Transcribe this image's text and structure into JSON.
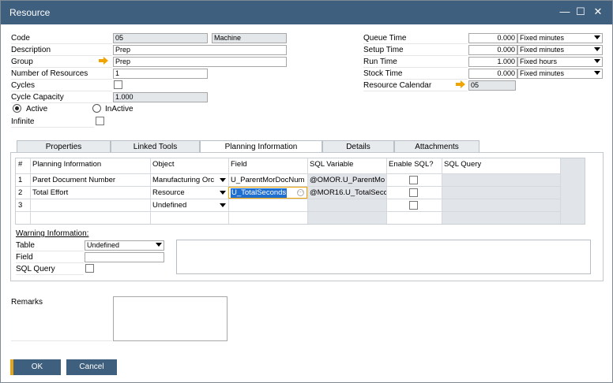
{
  "window": {
    "title": "Resource"
  },
  "header": {
    "code_label": "Code",
    "code_value": "05",
    "type_value": "Machine",
    "description_label": "Description",
    "description_value": "Prep",
    "group_label": "Group",
    "group_value": "Prep",
    "number_label": "Number of Resources",
    "number_value": "1",
    "cycles_label": "Cycles",
    "cycle_capacity_label": "Cycle Capacity",
    "cycle_capacity_value": "1.000",
    "active_label": "Active",
    "inactive_label": "InActive",
    "infinite_label": "Infinite"
  },
  "times": [
    {
      "label": "Queue Time",
      "value": "0.000",
      "unit": "Fixed minutes"
    },
    {
      "label": "Setup Time",
      "value": "0.000",
      "unit": "Fixed minutes"
    },
    {
      "label": "Run Time",
      "value": "1.000",
      "unit": "Fixed hours"
    },
    {
      "label": "Stock Time",
      "value": "0.000",
      "unit": "Fixed minutes"
    }
  ],
  "calendar": {
    "label": "Resource Calendar",
    "value": "05"
  },
  "tabs": [
    "Properties",
    "Linked Tools",
    "Planning Information",
    "Details",
    "Attachments"
  ],
  "grid": {
    "headers": [
      "#",
      "Planning Information",
      "Object",
      "Field",
      "SQL Variable",
      "Enable SQL?",
      "SQL Query"
    ],
    "rows": [
      {
        "num": "1",
        "info": "Paret Document Number",
        "object": "Manufacturing Orc",
        "field": "U_ParentMorDocNum",
        "sqlvar": "@OMOR.U_ParentMo"
      },
      {
        "num": "2",
        "info": "Total Effort",
        "object": "Resource",
        "field": "U_TotalSeconds",
        "sqlvar": "@MOR16.U_TotalSeco"
      },
      {
        "num": "3",
        "info": "",
        "object": "Undefined",
        "field": "",
        "sqlvar": ""
      }
    ]
  },
  "warning": {
    "title": "Warning Information:",
    "table_label": "Table",
    "table_value": "Undefined",
    "field_label": "Field",
    "field_value": "",
    "sql_label": "SQL Query"
  },
  "remarks_label": "Remarks",
  "buttons": {
    "ok": "OK",
    "cancel": "Cancel"
  },
  "colors": {
    "titlebar": "#3f5f7e",
    "ok_accent": "#e8a317",
    "button": "#3f5f7e",
    "selection": "#1f6fd0",
    "arrow": "#f0a400"
  }
}
